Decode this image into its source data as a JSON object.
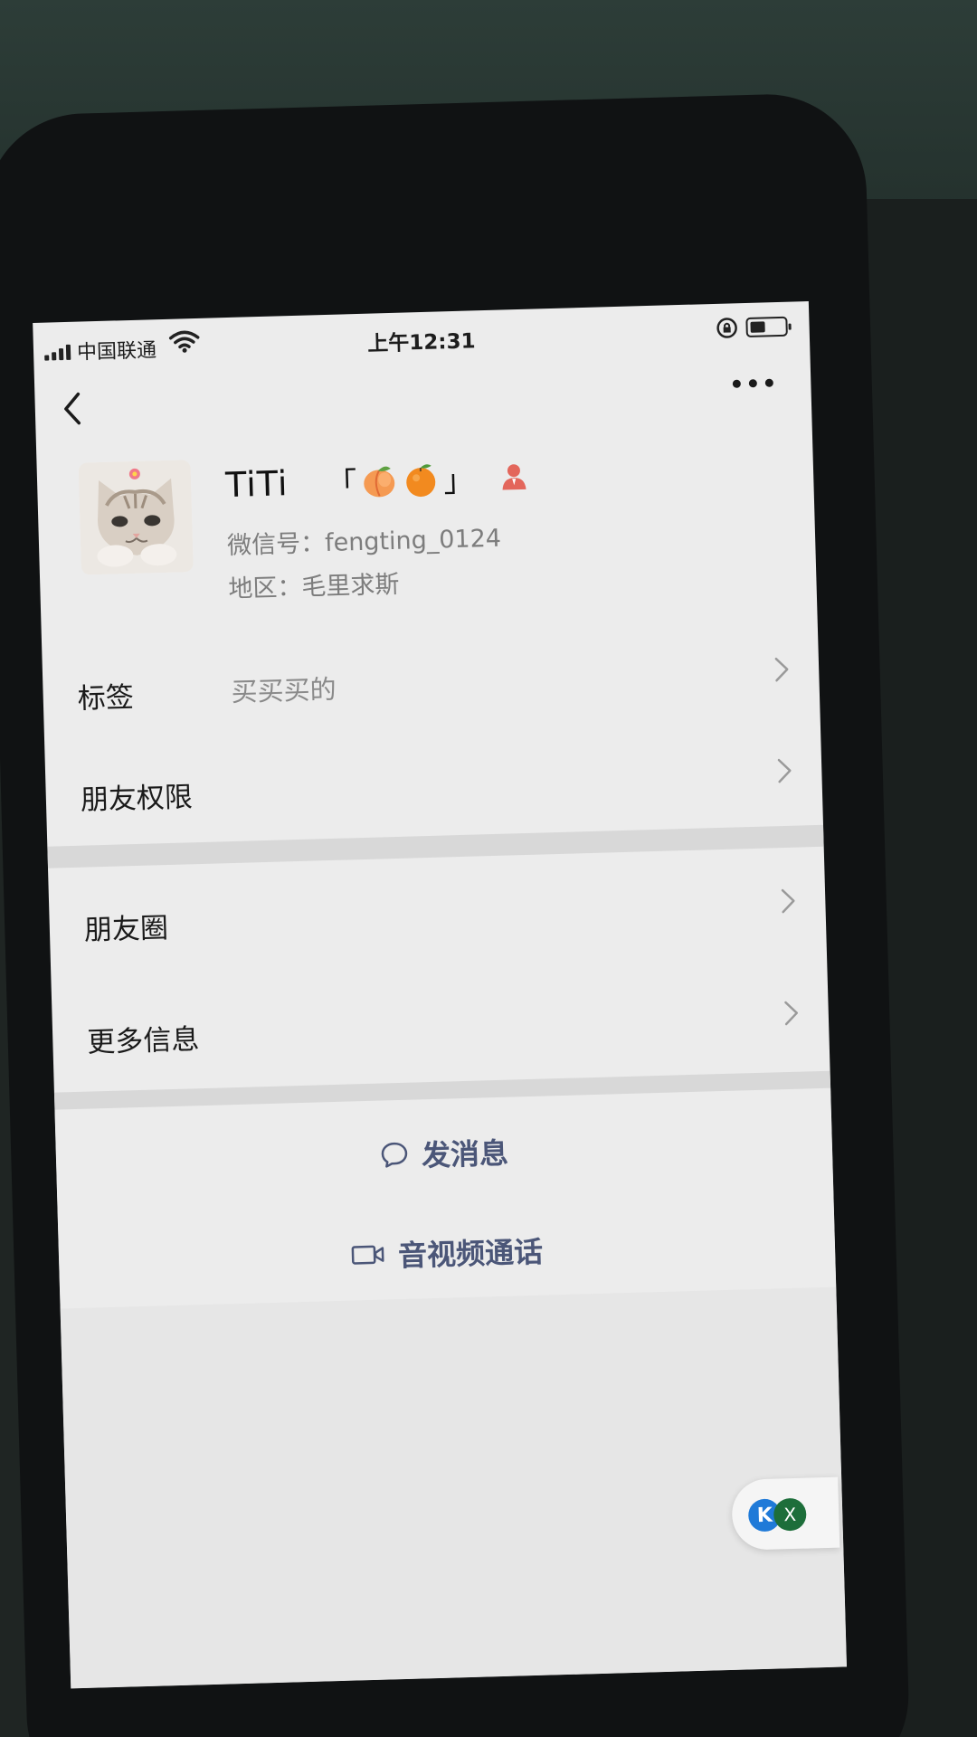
{
  "status_bar": {
    "carrier": "中国联通",
    "time": "上午12:31"
  },
  "profile": {
    "name": "TiTi",
    "bracket_open": "「",
    "bracket_close": "」",
    "wechat_id_label": "微信号：",
    "wechat_id": "fengting_0124",
    "region_label": "地区：",
    "region": "毛里求斯"
  },
  "list": [
    {
      "label": "标签",
      "value": "买买买的"
    },
    {
      "label": "朋友权限"
    },
    {
      "label": "朋友圈"
    },
    {
      "label": "更多信息"
    }
  ],
  "actions": {
    "send_message": "发消息",
    "av_call": "音视频通话"
  },
  "floating": {
    "k": "K",
    "close": "X"
  },
  "colors": {
    "screen_bg": "#ececec",
    "action_text": "#4b5678",
    "secondary_text": "#7d7d7d",
    "person_icon": "#e3665b"
  }
}
